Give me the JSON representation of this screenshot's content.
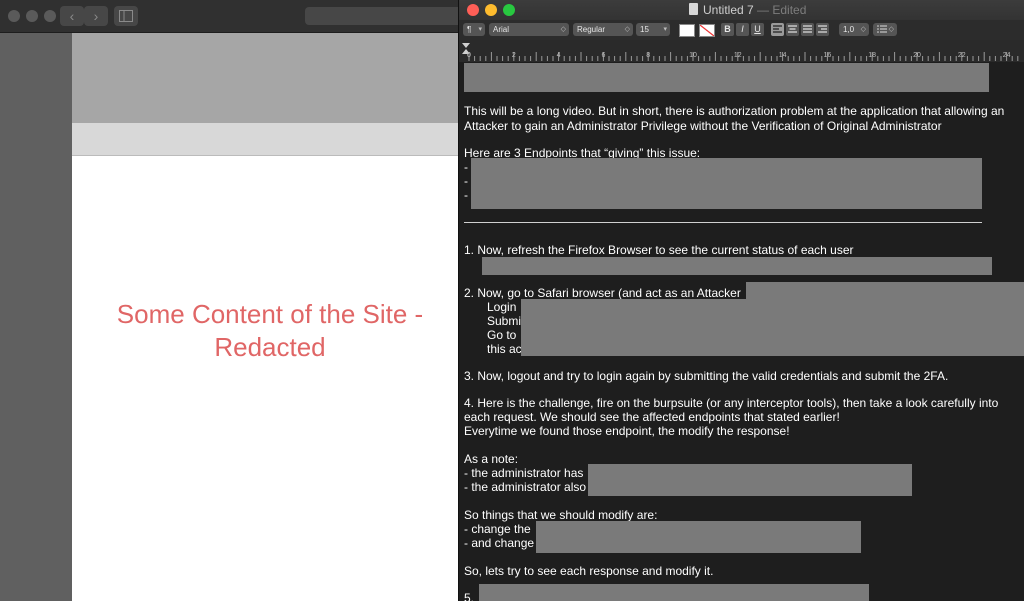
{
  "safari": {
    "back_symbol": "‹",
    "forward_symbol": "›",
    "site_content_text": "Some Content of the Site - Redacted"
  },
  "textedit": {
    "window_title": "Untitled 7",
    "edited_label": "— Edited",
    "format_bar": {
      "paragraph_style": "¶",
      "font_family": "Arial",
      "typeface": "Regular",
      "font_size": "15",
      "bold": "B",
      "italic": "I",
      "underline": "U",
      "line_spacing": "1,0"
    },
    "ruler_numbers": [
      "0",
      "2",
      "4",
      "6",
      "8",
      "10",
      "12",
      "14",
      "16",
      "18",
      "20",
      "22",
      "24"
    ],
    "lines": {
      "l01": "This will be a long video. But in short, there is authorization problem at the application that allowing an",
      "l02": "Attacker to gain an Administrator Privilege without the Verification of Original Administrator",
      "l03": "Here are 3 Endpoints that “giving” this issue:",
      "l04": "-",
      "l05": "-",
      "l06": "-",
      "l07": "1. Now, refresh the Firefox Browser to see the current status of each user",
      "l08": "2. Now, go to Safari browser (and act as an Attacker",
      "l09": "Login",
      "l10": "Submi",
      "l11": "Go to",
      "l12": "this ac",
      "l13": "3. Now, logout and try to login again by submitting the valid credentials and submit the 2FA.",
      "l14": "4. Here is the challenge, fire on the burpsuite (or any interceptor tools), then take a look carefully into",
      "l15": "each request. We should see the affected endpoints that stated earlier!",
      "l16": "Everytime we found those endpoint, the modify the response!",
      "l17": "As a note:",
      "l18": "- the administrator has",
      "l19": "- the administrator also",
      "l20": "So things that we should modify are:",
      "l21": "- change the",
      "l22": "- and change",
      "l23": "So, lets try to see each response and modify it.",
      "l24": "5."
    }
  }
}
